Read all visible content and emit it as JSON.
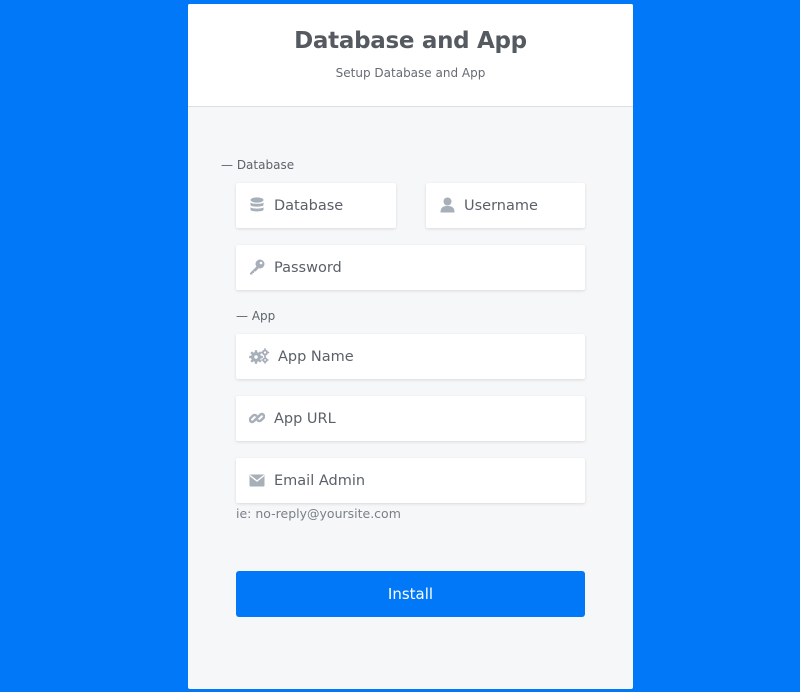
{
  "header": {
    "title": "Database and App",
    "subtitle": "Setup Database and App"
  },
  "sections": {
    "database_label": "— Database",
    "app_label": "— App"
  },
  "fields": {
    "database": {
      "placeholder": "Database",
      "icon": "database-icon"
    },
    "username": {
      "placeholder": "Username",
      "icon": "user-icon"
    },
    "password": {
      "placeholder": "Password",
      "icon": "key-icon"
    },
    "app_name": {
      "placeholder": "App Name",
      "icon": "gears-icon"
    },
    "app_url": {
      "placeholder": "App URL",
      "icon": "link-icon"
    },
    "email_admin": {
      "placeholder": "Email Admin",
      "icon": "envelope-icon"
    }
  },
  "email_hint": "ie: no-reply@yoursite.com",
  "install_label": "Install",
  "colors": {
    "background": "#0078f8",
    "primary_button": "#0078f8",
    "icon": "#a7afb9"
  }
}
